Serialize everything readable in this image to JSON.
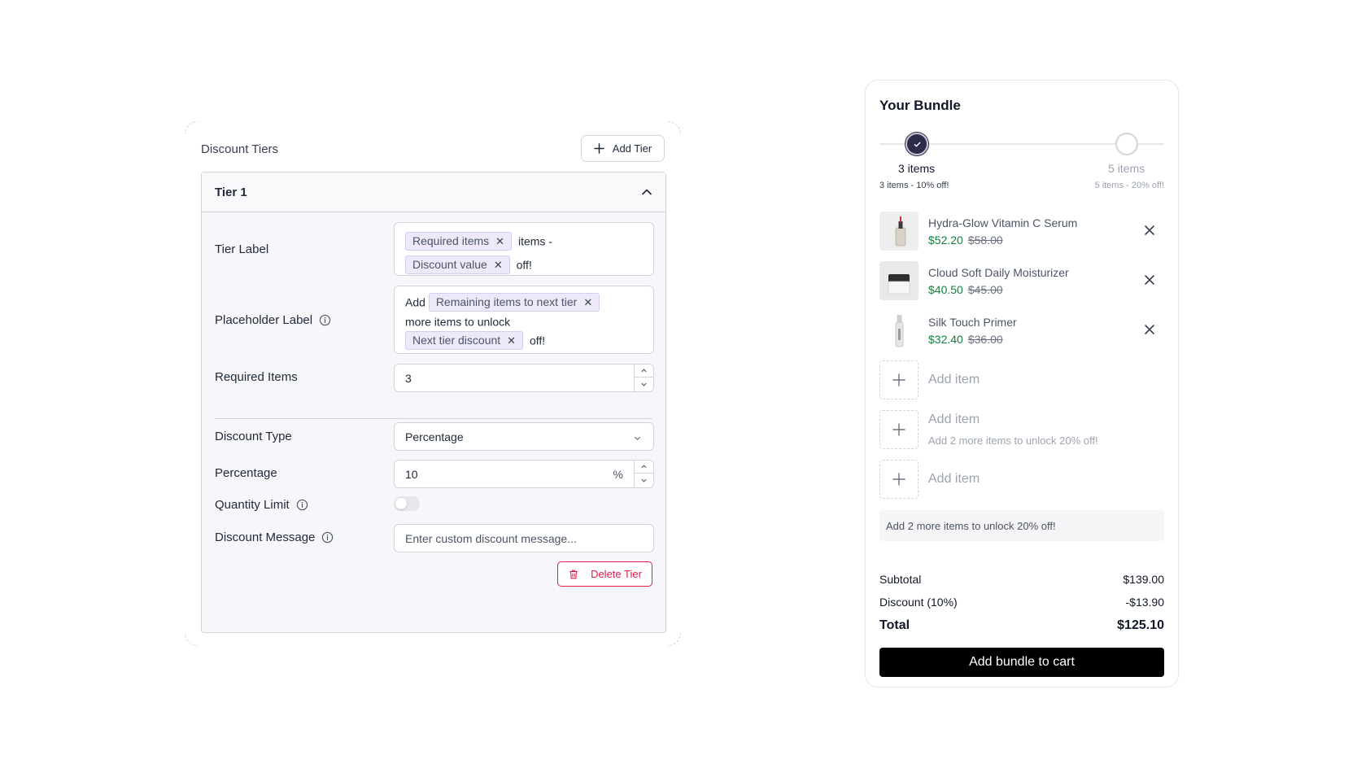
{
  "discount_tiers": {
    "title": "Discount Tiers",
    "add_tier_label": "Add Tier",
    "tier": {
      "name": "Tier 1",
      "tier_label": {
        "label": "Tier Label",
        "chip_required": "Required items",
        "text_items": "items -",
        "chip_discount": "Discount value",
        "text_off": "off!"
      },
      "placeholder_label": {
        "label": "Placeholder Label",
        "text_add": "Add",
        "chip_remaining": "Remaining items to next tier",
        "text_more": "more items to unlock",
        "chip_next": "Next tier discount",
        "text_off": "off!"
      },
      "required_items": {
        "label": "Required Items",
        "value": "3"
      },
      "discount_type": {
        "label": "Discount Type",
        "value": "Percentage"
      },
      "percentage": {
        "label": "Percentage",
        "value": "10",
        "unit": "%"
      },
      "quantity_limit": {
        "label": "Quantity Limit",
        "enabled": false
      },
      "discount_message": {
        "label": "Discount Message",
        "placeholder": "Enter custom discount message..."
      },
      "delete_label": "Delete Tier"
    }
  },
  "bundle": {
    "title": "Your Bundle",
    "steps": [
      {
        "label": "3 items",
        "sub": "3 items - 10% off!",
        "done": true
      },
      {
        "label": "5 items",
        "sub": "5 items - 20% off!",
        "done": false
      }
    ],
    "items": [
      {
        "name": "Hydra-Glow Vitamin C Serum",
        "price": "$52.20",
        "original": "$58.00"
      },
      {
        "name": "Cloud Soft Daily Moisturizer",
        "price": "$40.50",
        "original": "$45.00"
      },
      {
        "name": "Silk Touch Primer",
        "price": "$32.40",
        "original": "$36.00"
      }
    ],
    "slots": [
      {
        "label": "Add item",
        "sub": ""
      },
      {
        "label": "Add item",
        "sub": "Add 2 more items to unlock 20% off!"
      },
      {
        "label": "Add item",
        "sub": ""
      }
    ],
    "unlock_message": "Add 2 more items to unlock 20% off!",
    "subtotal_label": "Subtotal",
    "subtotal_value": "$139.00",
    "discount_label": "Discount (10%)",
    "discount_value": "-$13.90",
    "total_label": "Total",
    "total_value": "$125.10",
    "cart_button": "Add bundle to cart"
  },
  "colors": {
    "accent_chip": "#ede9fb",
    "price_green": "#15803d",
    "danger": "#e11d48",
    "step_done": "#2c2c4a"
  }
}
